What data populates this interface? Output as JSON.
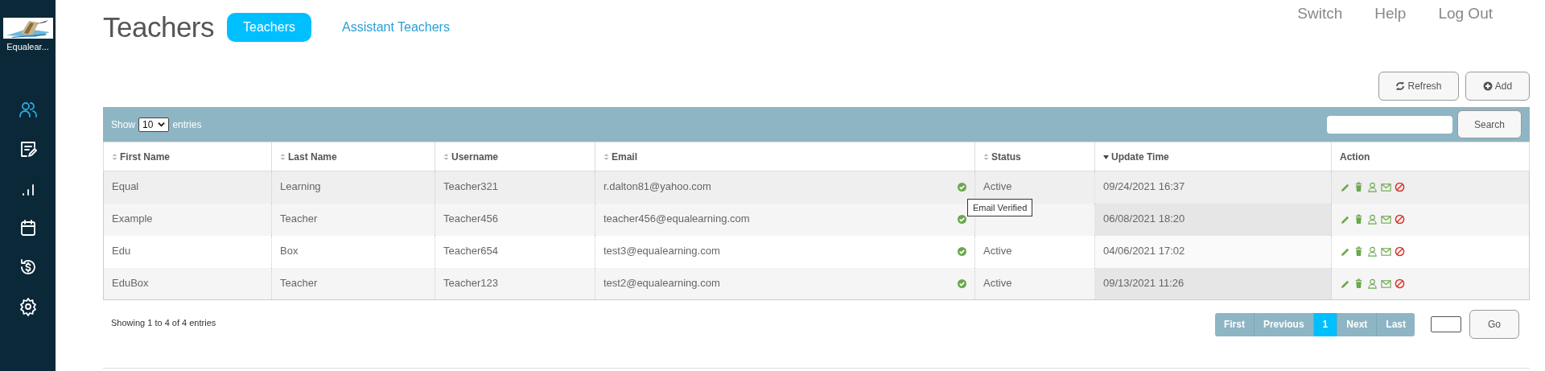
{
  "sidebar": {
    "logo_text": "Equalear...",
    "items": [
      {
        "kind": "users",
        "selected": true
      },
      {
        "kind": "edit",
        "selected": false
      },
      {
        "kind": "chart",
        "selected": false
      },
      {
        "kind": "calendar",
        "selected": false
      },
      {
        "kind": "money",
        "selected": false
      },
      {
        "kind": "settings",
        "selected": false
      }
    ]
  },
  "header": {
    "title": "Teachers",
    "tabs": [
      {
        "label": "Teachers",
        "selected": true
      },
      {
        "label": "Assistant Teachers",
        "selected": false
      }
    ],
    "links": [
      "Switch",
      "Help",
      "Log Out"
    ]
  },
  "toolbar": {
    "buttons": [
      {
        "kind": "refresh",
        "label": "Refresh"
      },
      {
        "kind": "add",
        "label": "Add"
      }
    ]
  },
  "table": {
    "length_control": {
      "prefix": "Show",
      "value": "10",
      "suffix": "entries"
    },
    "search_button": "Search",
    "columns": [
      {
        "label": "First Name",
        "sorted": false
      },
      {
        "label": "Last Name",
        "sorted": false
      },
      {
        "label": "Username",
        "sorted": false
      },
      {
        "label": "Email",
        "sorted": false
      },
      {
        "label": "Status",
        "sorted": false
      },
      {
        "label": "Update Time",
        "sorted": true
      },
      {
        "label": "Action"
      }
    ],
    "rows": [
      {
        "first_name": "Equal",
        "last_name": "Learning",
        "username": "Teacher321",
        "email": "r.dalton81@yahoo.com",
        "email_verified": true,
        "status": "Active",
        "update_time": "09/24/2021 16:37",
        "highlighted": true
      },
      {
        "first_name": "Example",
        "last_name": "Teacher",
        "username": "Teacher456",
        "email": "teacher456@equalearning.com",
        "email_verified": true,
        "tooltip": "Email Verified",
        "update_time": "06/08/2021 18:20",
        "highlighted": false
      },
      {
        "first_name": "Edu",
        "last_name": "Box",
        "username": "Teacher654",
        "email": "test3@equalearning.com",
        "email_verified": true,
        "status": "Active",
        "update_time": "04/06/2021 17:02",
        "highlighted": false
      },
      {
        "first_name": "EduBox",
        "last_name": "Teacher",
        "username": "Teacher123",
        "email": "test2@equalearning.com",
        "email_verified": true,
        "status": "Active",
        "update_time": "09/13/2021 11:26",
        "highlighted": false
      }
    ],
    "info": "Showing 1 to 4 of 4 entries"
  },
  "pagination": {
    "pages": [
      {
        "label": "First",
        "selected": false
      },
      {
        "label": "Previous",
        "selected": false
      },
      {
        "label": "1",
        "selected": true
      },
      {
        "label": "Next",
        "selected": false
      },
      {
        "label": "Last",
        "selected": false
      }
    ],
    "go_button": "Go"
  }
}
